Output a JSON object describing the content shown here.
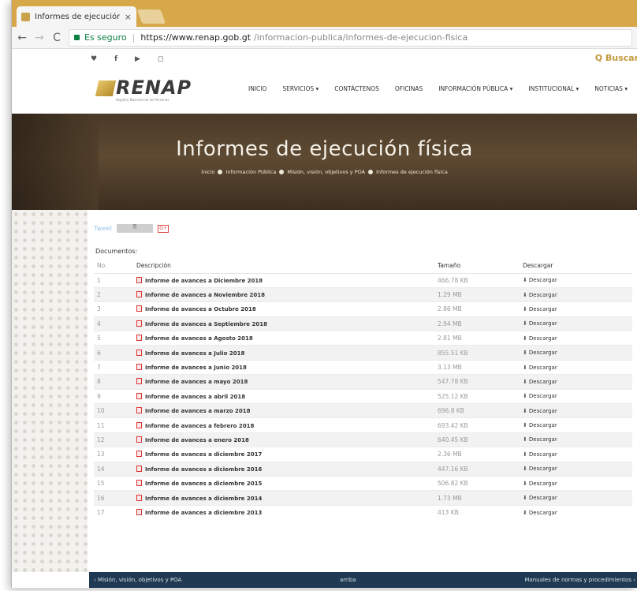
{
  "browser": {
    "tab_title": "Informes de ejecución fís",
    "tab_close": "×",
    "back": "←",
    "forward": "→",
    "reload": "C",
    "secure_label": "Es seguro",
    "url_host": "https://www.renap.gob.gt",
    "url_path": "/informacion-publica/informes-de-ejecucion-fisica"
  },
  "topbar": {
    "social": [
      "♥",
      "f",
      "▶",
      "◻"
    ],
    "search": "Q Buscar"
  },
  "logo": {
    "text": "RENAP",
    "subtitle": "Registro Nacional de las Personas"
  },
  "menu": [
    "Inicio",
    "Servicios ▾",
    "Contáctenos",
    "Oficinas",
    "Información Pública ▾",
    "Institucional ▾",
    "Noticias ▾"
  ],
  "hero": {
    "title": "Informes de ejecución física",
    "breadcrumb": [
      "Inicio",
      "Información Pública",
      "Misión, visión, objetivos y POA",
      "Informes de ejecución física"
    ]
  },
  "share": {
    "tweet": "Tweet",
    "share_label": "⎘",
    "gplus": "G+"
  },
  "documents": {
    "label": "Documentos:",
    "headers": [
      "No.",
      "Descripción",
      "Tamaño",
      "Descargar"
    ],
    "download_label": "Descargar",
    "rows": [
      {
        "no": "1",
        "desc": "Informe de avances a Diciembre 2018",
        "size": "466.78 KB"
      },
      {
        "no": "2",
        "desc": "Informe de avances a Noviembre 2018",
        "size": "1.29 MB"
      },
      {
        "no": "3",
        "desc": "Informe de avances a Octubre 2018",
        "size": "2.86 MB"
      },
      {
        "no": "4",
        "desc": "Informe de avances a Septiembre 2018",
        "size": "2.94 MB"
      },
      {
        "no": "5",
        "desc": "Informe de avances a Agosto 2018",
        "size": "2.81 MB"
      },
      {
        "no": "6",
        "desc": "Informe de avances a Julio 2018",
        "size": "855.51 KB"
      },
      {
        "no": "7",
        "desc": "Informe de avances a Junio 2018",
        "size": "3.13 MB"
      },
      {
        "no": "8",
        "desc": "Informe de avances a mayo 2018",
        "size": "547.78 KB"
      },
      {
        "no": "9",
        "desc": "Informe de avances a abril 2018",
        "size": "525.12 KB"
      },
      {
        "no": "10",
        "desc": "Informe de avances a marzo 2018",
        "size": "696.8 KB"
      },
      {
        "no": "11",
        "desc": "Informe de avances a febrero 2018",
        "size": "693.42 KB"
      },
      {
        "no": "12",
        "desc": "Informe de avances a enero 2018",
        "size": "640.45 KB"
      },
      {
        "no": "13",
        "desc": "Informe de avances a diciembre 2017",
        "size": "2.36 MB"
      },
      {
        "no": "14",
        "desc": "Informe de avances a diciembre 2016",
        "size": "447.16 KB"
      },
      {
        "no": "15",
        "desc": "Informe de avances a diciembre 2015",
        "size": "506.82 KB"
      },
      {
        "no": "16",
        "desc": "Informe de avances a diciembre 2014",
        "size": "1.73 MB"
      },
      {
        "no": "17",
        "desc": "Informe de avances a diciembre 2013",
        "size": "413 KB"
      }
    ]
  },
  "footer": {
    "prev": "‹ Misión, visión, objetivos y POA",
    "top": "arriba",
    "next": "Manuales de normas y procedimientos ›"
  }
}
